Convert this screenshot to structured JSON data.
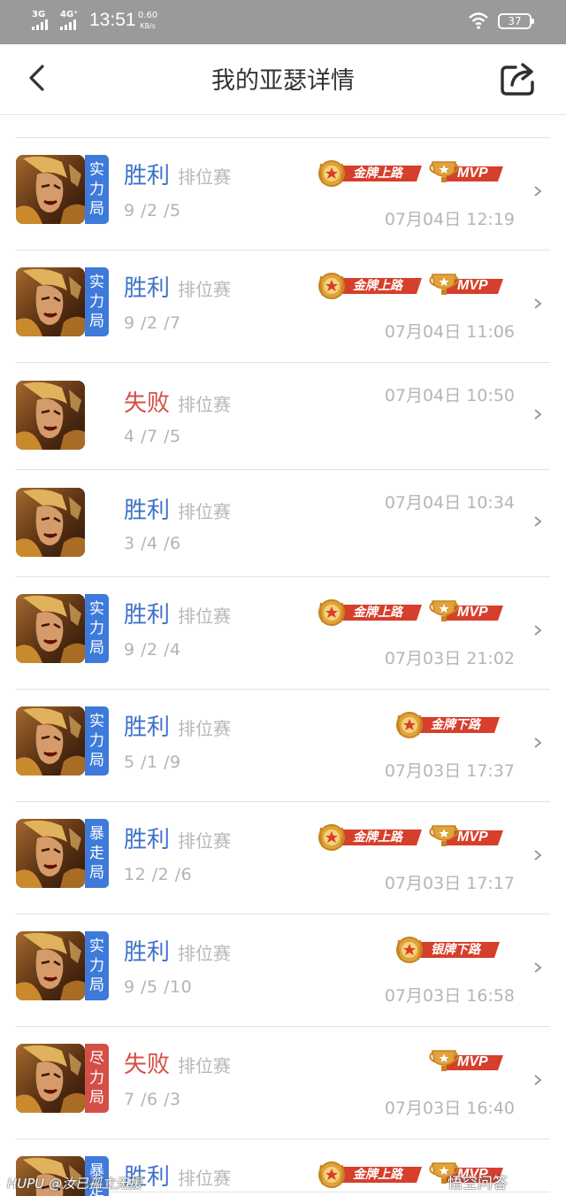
{
  "status_bar": {
    "network_1": "3G",
    "network_2": "4G⁺",
    "time": "13:51",
    "speed_value": "0.60",
    "speed_unit": "KB/s",
    "battery": "37"
  },
  "header": {
    "title": "我的亚瑟详情",
    "back_icon": "chevron-left-icon",
    "share_icon": "share-export-icon"
  },
  "colors": {
    "win": "#3d72c9",
    "lose": "#d34f44",
    "tag_blue": "#3e7ad9",
    "tag_red": "#d44f45",
    "gold": "#c8841f",
    "badge_red": "#d63f2b"
  },
  "matches": [
    {
      "tag": [
        "实",
        "力",
        "局"
      ],
      "tag_color": "blue",
      "result": "胜利",
      "result_type": "win",
      "mode": "排位赛",
      "kda": "9 /2 /5",
      "badges": [
        "金牌上路",
        "MVP"
      ],
      "time": "07月04日 12:19"
    },
    {
      "tag": [
        "实",
        "力",
        "局"
      ],
      "tag_color": "blue",
      "result": "胜利",
      "result_type": "win",
      "mode": "排位赛",
      "kda": "9 /2 /7",
      "badges": [
        "金牌上路",
        "MVP"
      ],
      "time": "07月04日 11:06"
    },
    {
      "tag": [],
      "tag_color": "",
      "result": "失败",
      "result_type": "lose",
      "mode": "排位赛",
      "kda": "4 /7 /5",
      "badges": [],
      "time": "07月04日 10:50"
    },
    {
      "tag": [],
      "tag_color": "",
      "result": "胜利",
      "result_type": "win",
      "mode": "排位赛",
      "kda": "3 /4 /6",
      "badges": [],
      "time": "07月04日 10:34"
    },
    {
      "tag": [
        "实",
        "力",
        "局"
      ],
      "tag_color": "blue",
      "result": "胜利",
      "result_type": "win",
      "mode": "排位赛",
      "kda": "9 /2 /4",
      "badges": [
        "金牌上路",
        "MVP"
      ],
      "time": "07月03日 21:02"
    },
    {
      "tag": [
        "实",
        "力",
        "局"
      ],
      "tag_color": "blue",
      "result": "胜利",
      "result_type": "win",
      "mode": "排位赛",
      "kda": "5 /1 /9",
      "badges": [
        "金牌下路"
      ],
      "time": "07月03日 17:37"
    },
    {
      "tag": [
        "暴",
        "走",
        "局"
      ],
      "tag_color": "blue",
      "result": "胜利",
      "result_type": "win",
      "mode": "排位赛",
      "kda": "12 /2 /6",
      "badges": [
        "金牌上路",
        "MVP"
      ],
      "time": "07月03日 17:17"
    },
    {
      "tag": [
        "实",
        "力",
        "局"
      ],
      "tag_color": "blue",
      "result": "胜利",
      "result_type": "win",
      "mode": "排位赛",
      "kda": "9 /5 /10",
      "badges": [
        "银牌下路"
      ],
      "time": "07月03日 16:58"
    },
    {
      "tag": [
        "尽",
        "力",
        "局"
      ],
      "tag_color": "red",
      "result": "失败",
      "result_type": "lose",
      "mode": "排位赛",
      "kda": "7 /6 /3",
      "badges": [
        "MVP"
      ],
      "time": "07月03日 16:40"
    },
    {
      "tag": [
        "暴",
        "走"
      ],
      "tag_color": "blue",
      "result": "胜利",
      "result_type": "win",
      "mode": "排位赛",
      "kda": "",
      "badges": [
        "金牌上路",
        "MVP"
      ],
      "time": ""
    }
  ],
  "watermarks": {
    "left": "HUPU @汝已孤立无援",
    "right": "悟空问答"
  }
}
